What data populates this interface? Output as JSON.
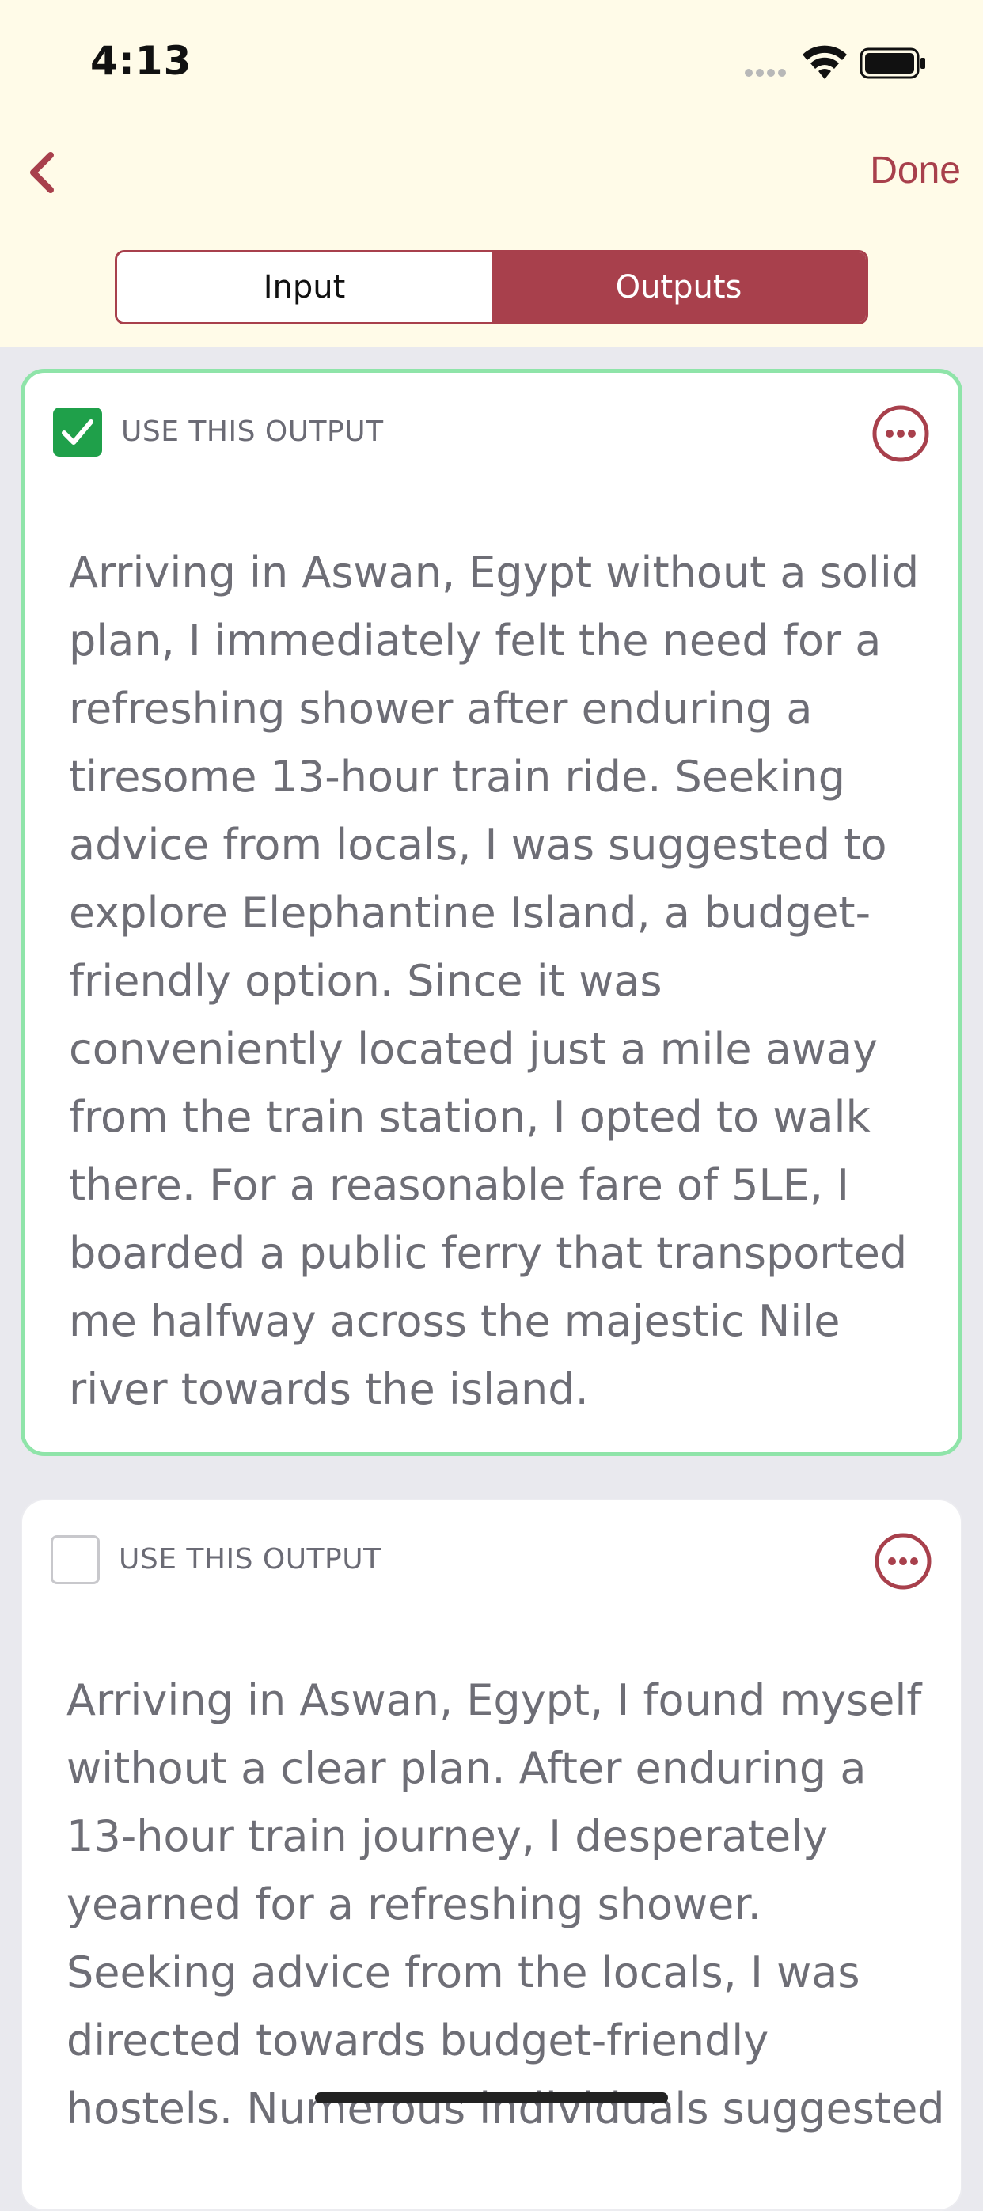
{
  "status_bar": {
    "time": "4:13"
  },
  "nav": {
    "back_icon": "chevron-left-icon",
    "done_label": "Done"
  },
  "segmented_control": {
    "input_label": "Input",
    "outputs_label": "Outputs",
    "selected": "Outputs"
  },
  "outputs": [
    {
      "checked": true,
      "use_label": "USE THIS OUTPUT",
      "more_icon": "more-options-icon",
      "text": "Arriving in Aswan, Egypt without a solid plan, I immediately felt the need for a refreshing shower after enduring a tiresome 13-hour train ride. Seeking advice from locals, I was suggested to explore Elephantine Island, a budget-friendly option. Since it was conveniently located just a mile away from the train station, I opted to walk there. For a reasonable fare of 5LE, I boarded a public ferry that transported me halfway across the majestic Nile river towards the island."
    },
    {
      "checked": false,
      "use_label": "USE THIS OUTPUT",
      "more_icon": "more-options-icon",
      "text": "Arriving in Aswan, Egypt, I found myself without a clear plan. After enduring a 13-hour train journey, I desperately yearned for a refreshing shower. Seeking advice from the locals, I was directed towards budget-friendly hostels. Numerous individuals suggested"
    }
  ],
  "colors": {
    "accent": "#a8404c",
    "header_bg": "#fffbe8",
    "selected_border": "#8fe4a9",
    "checkbox_green": "#1fa04a"
  }
}
